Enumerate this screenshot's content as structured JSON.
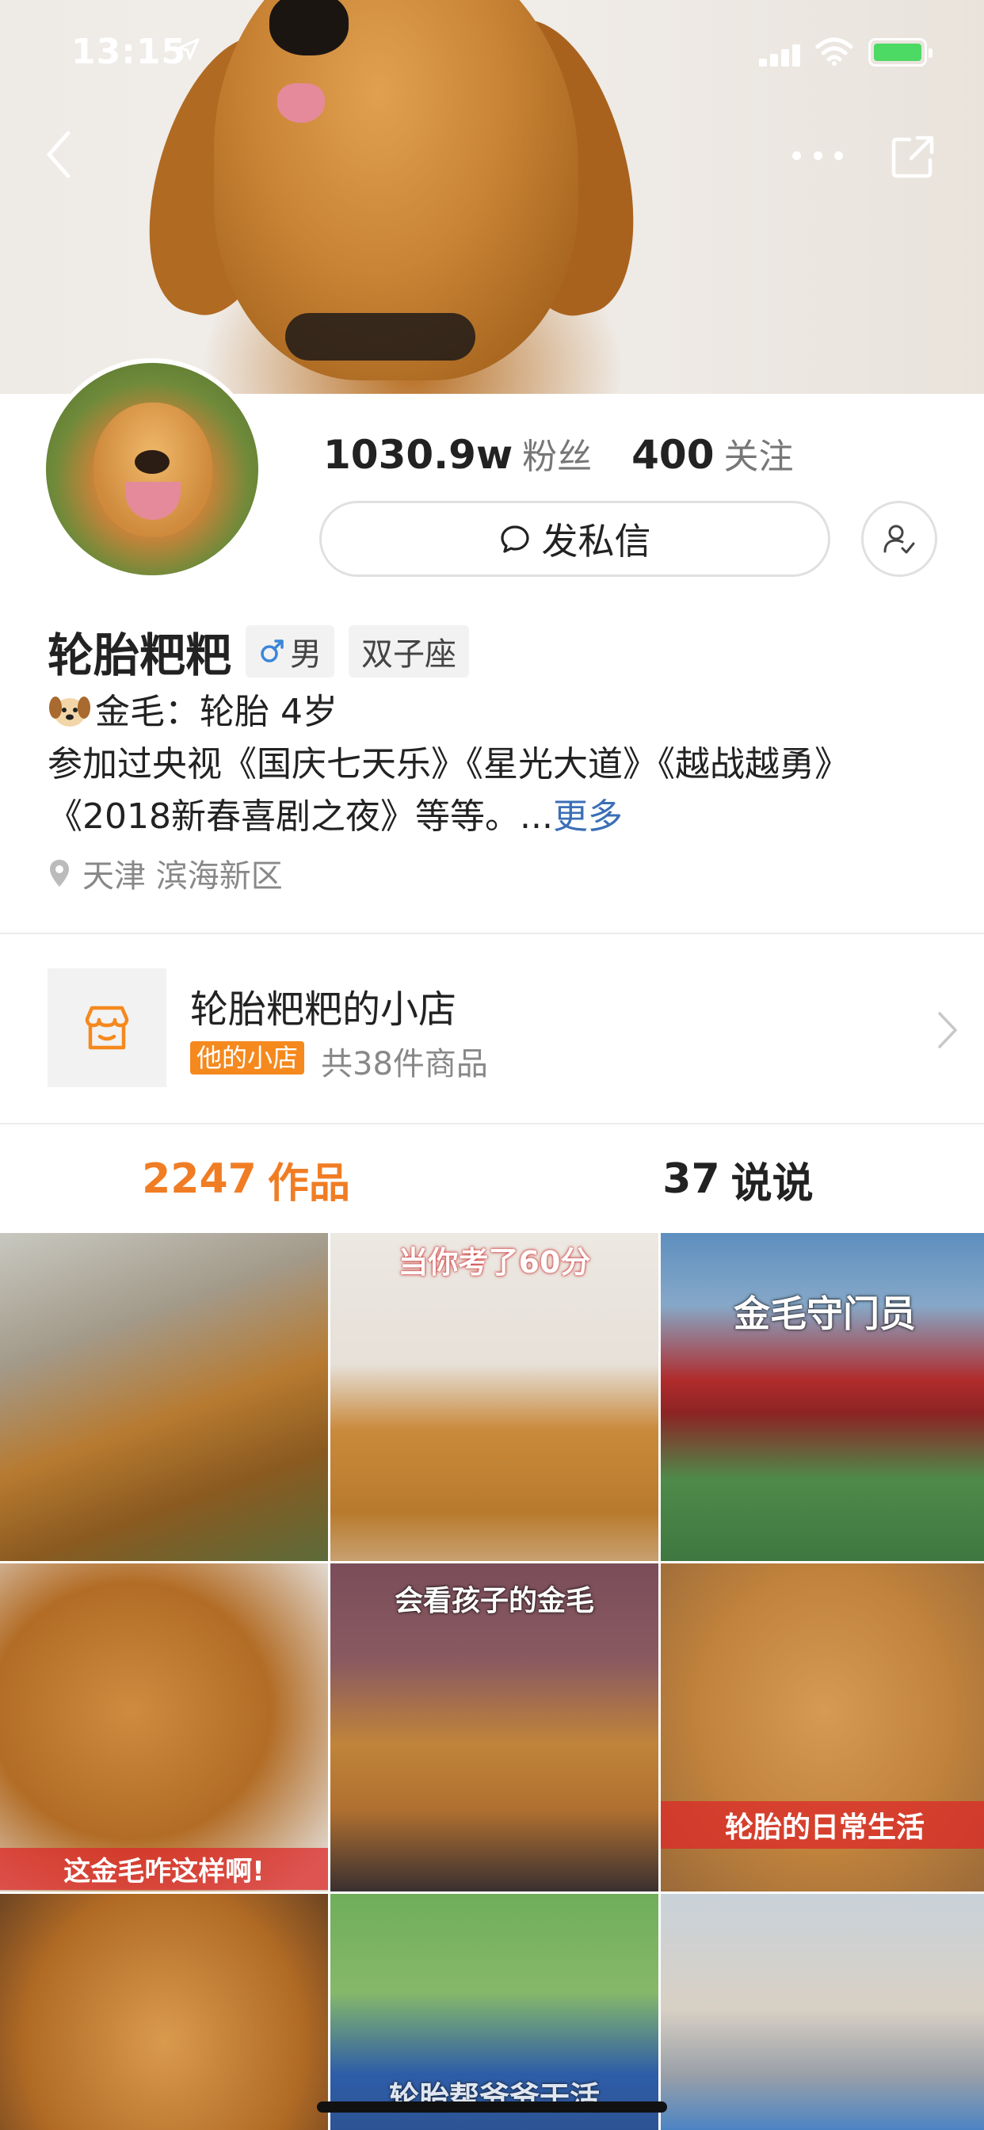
{
  "status_bar": {
    "time": "13:15"
  },
  "profile": {
    "fans_count": "1030.9w",
    "fans_label": "粉丝",
    "following_count": "400",
    "following_label": "关注",
    "message_button": "发私信",
    "name": "轮胎粑粑",
    "gender": "男",
    "zodiac": "双子座",
    "bio_line1": "金毛：轮胎   4岁",
    "bio_line2": "参加过央视《国庆七天乐》《星光大道》《越战越勇》《2018新春喜剧之夜》等等。...",
    "bio_more": "更多",
    "location": "天津 滨海新区"
  },
  "shop": {
    "title": "轮胎粑粑的小店",
    "badge": "他的小店",
    "count": "共38件商品"
  },
  "tabs": [
    {
      "count": "2247",
      "label": "作品"
    },
    {
      "count": "37",
      "label": "说说"
    }
  ],
  "grid": [
    {
      "caption": ""
    },
    {
      "caption": "当你考了60分"
    },
    {
      "caption": "金毛守门员"
    },
    {
      "caption": "这金毛咋这样啊!"
    },
    {
      "caption": "会看孩子的金毛"
    },
    {
      "caption": "轮胎的日常生活"
    },
    {
      "caption": ""
    },
    {
      "caption": "轮胎帮爷爷干活"
    },
    {
      "caption": ""
    }
  ],
  "colors": {
    "accent": "#f07d24",
    "link": "#3b6fb6",
    "badge": "#f5891e"
  }
}
